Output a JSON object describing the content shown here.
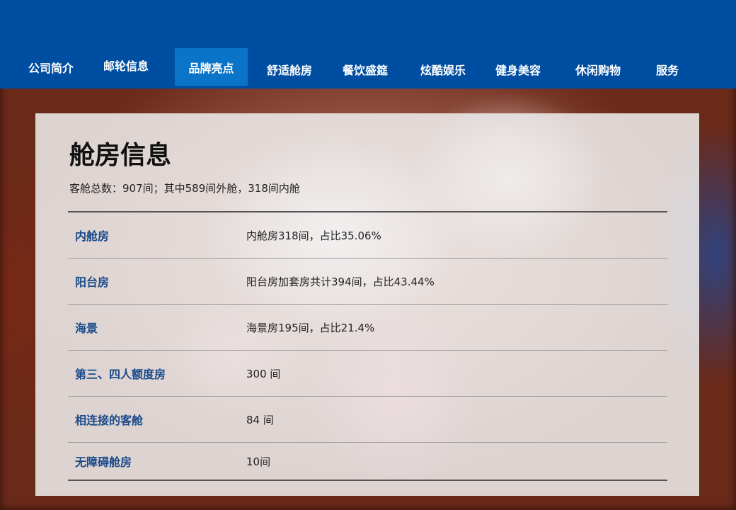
{
  "nav": {
    "items": [
      {
        "label": "公司简介"
      },
      {
        "label": "邮轮信息"
      },
      {
        "label": "品牌亮点"
      },
      {
        "label": "舒适舱房"
      },
      {
        "label": "餐饮盛筵"
      },
      {
        "label": "炫酷娱乐"
      },
      {
        "label": "健身美容"
      },
      {
        "label": "休闲购物"
      },
      {
        "label": "服务"
      }
    ],
    "active": "品牌亮点"
  },
  "content": {
    "title": "舱房信息",
    "summary": "客舱总数：907间；其中589间外舱，318间内舱",
    "rows": [
      {
        "label": "内舱房",
        "value": "内舱房318间，占比35.06%"
      },
      {
        "label": "阳台房",
        "value": "阳台房加套房共计394间，占比43.44%"
      },
      {
        "label": "海景",
        "value": "海景房195间，占比21.4%"
      },
      {
        "label": "第三、四人额度房",
        "value": "300 间"
      },
      {
        "label": "相连接的客舱",
        "value": "84 间"
      },
      {
        "label": "无障碍舱房",
        "value": "10间"
      }
    ]
  },
  "colors": {
    "nav_bg": "#004ea2",
    "nav_active_bg": "#0a74c8",
    "row_label": "#1a4a8a"
  }
}
